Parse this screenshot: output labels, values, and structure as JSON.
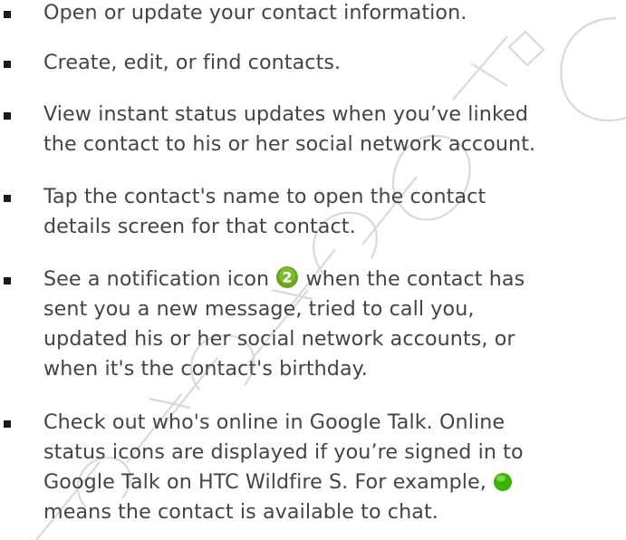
{
  "watermark": {
    "text": "Certification",
    "color": "#d9d9d9"
  },
  "items": [
    {
      "lines": [
        "Open or update your contact information."
      ]
    },
    {
      "lines": [
        "Create, edit, or find contacts."
      ]
    },
    {
      "lines": [
        "View instant status updates when you’ve linked",
        "the contact to his or her social network account."
      ]
    },
    {
      "lines": [
        "Tap the contact's name to open the contact",
        "details screen for that contact."
      ]
    },
    {
      "line1_before_icon": "See a notification icon ",
      "notification_icon": {
        "name": "notification-count-icon",
        "badge": "2",
        "color": "#6aa520"
      },
      "line1_after_icon": " when the contact has",
      "lines_rest": [
        "sent you a new message, tried to call you,",
        "updated his or her social network accounts, or",
        "when it's the contact's birthday."
      ]
    },
    {
      "lines_before": [
        "Check out who's online in Google Talk. Online",
        "status icons are displayed if you’re signed in to"
      ],
      "line3_before_icon": "Google Talk on HTC Wildfire S. For example, ",
      "status_icon": {
        "name": "available-status-icon",
        "color": "#3cb300"
      },
      "lines_after": [
        "means the contact is available to chat."
      ]
    }
  ]
}
